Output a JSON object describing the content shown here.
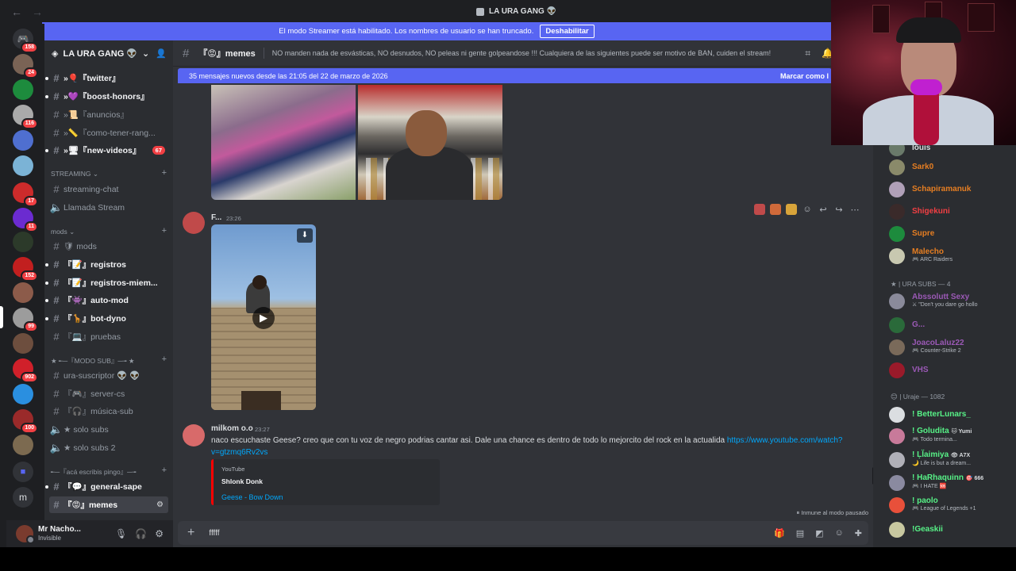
{
  "window": {
    "title": "LA URA GANG 👽",
    "back_glyph": "←",
    "forward_glyph": "→"
  },
  "streamer_banner": {
    "text": "El modo Streamer está habilitado. Los nombres de usuario se han truncado.",
    "button": "Deshabilitar"
  },
  "server_rail": {
    "badges": [
      "158",
      "24",
      "116",
      "17",
      "11",
      "152",
      "99",
      "902",
      "100"
    ],
    "m_label": "m"
  },
  "guild": {
    "name": "LA URA GANG 👽",
    "chevron": "⌄"
  },
  "channels": {
    "twitter": "»🎈『twitter』",
    "boost": "»💜『boost-honors』",
    "anuncios": "»📜『anuncios』",
    "como_tener": "»📏『como-tener-rang...",
    "new_videos": "»🖥『new-videos』",
    "new_videos_count": "67",
    "cat_streaming": "STREAMING ⌄",
    "streaming_chat": "streaming-chat",
    "llamada_stream": "Llamada Stream",
    "cat_mods": "mods ⌄",
    "mods": "🛡 mods",
    "registros": "『📝』registros",
    "registros_miem": "『📝』registros-miem...",
    "auto_mod": "『👾』auto-mod",
    "bot_dyno": "『🦒』bot-dyno",
    "pruebas": "『💻』pruebas",
    "cat_modo_sub": "★ ╾─『MODO SUB』─╼ ★",
    "ura_suscriptor": "ura-suscriptor 👽 👽",
    "server_cs": "『🎮』server-cs",
    "musica_sub": "『🎧』música-sub",
    "solo_subs": "★ solo subs",
    "solo_subs_2": "★ solo subs 2",
    "cat_aca": "╾─『acá escribis pingo』─╼",
    "general_sape": "『💬』general-sape",
    "memes": "『😡』memes"
  },
  "user_panel": {
    "name": "Mr Nacho...",
    "status": "Invisible"
  },
  "chat_header": {
    "channel": "『😡』memes",
    "topic": "NO manden nada de esvásticas, NO desnudos, NO peleas ni gente golpeandose !!! Cualquiera de las siguientes puede ser motivo de BAN, cuiden el stream!"
  },
  "new_messages": {
    "text": "35 mensajes nuevos desde las 21:05 del 22 de marzo de 2026",
    "mark": "Marcar como l"
  },
  "messages": [
    {
      "author": "F...",
      "time": "23:26",
      "color": "#3ba55d"
    },
    {
      "author": "milkom o.o",
      "time": "23:27",
      "color": "#3ba55d",
      "text": "naco escuchaste Geese? creo que con tu voz de negro podrias cantar asi. Dale una chance es dentro de todo lo mejorcito  del rock en la actualida ",
      "link": "https://www.youtube.com/watch?v=gtzmq6Rv2vs",
      "embed": {
        "provider": "YouTube",
        "author": "Shlonk Donk",
        "title": "Geese - Bow Down"
      }
    }
  ],
  "paused_note": "⏸ Inmune al modo pausado",
  "composer": {
    "plus": "+",
    "value": "fffff"
  },
  "members": {
    "top": [
      {
        "name": "louis",
        "activity": "",
        "color": "#dbdee1"
      },
      {
        "name": "Sark0",
        "activity": "",
        "color": "#e67e22"
      },
      {
        "name": "Schapiramanuk",
        "activity": "",
        "color": "#e67e22"
      },
      {
        "name": "Shigekuni",
        "activity": "",
        "color": "#f23f43"
      },
      {
        "name": "Supre",
        "activity": "",
        "color": "#e67e22"
      },
      {
        "name": "Malecho",
        "activity": "🎮 ARC Raiders",
        "color": "#e67e22"
      }
    ],
    "section_subs": "★ | URA SUBS — 4",
    "subs": [
      {
        "name": "Abssolutt Sexy",
        "activity": "⚔ \"Don't you dare go hollo",
        "color": "#9b59b6"
      },
      {
        "name": "G...",
        "activity": "",
        "color": "#9b59b6"
      },
      {
        "name": "JoacoLaluz22",
        "activity": "🎮 Counter-Strike 2",
        "color": "#9b59b6"
      },
      {
        "name": "VHS",
        "activity": "",
        "color": "#9b59b6"
      }
    ],
    "section_uraje": "😊 | Uraje — 1082",
    "uraje": [
      {
        "name": "! BetterLunars_",
        "activity": "",
        "color": "#57f287"
      },
      {
        "name": "! Goludita",
        "activity": "🎮 Todo termina...",
        "color": "#57f287",
        "tag": "🐱 Yumi"
      },
      {
        "name": "! Ḷl̈aimiya",
        "activity": "🌙 Life is but a dream...",
        "color": "#57f287",
        "tag": "👁 A7X"
      },
      {
        "name": "! HaRhaquinn",
        "activity": "🎮 I HATE 🆘",
        "color": "#57f287",
        "tag": "🎯 666"
      },
      {
        "name": "! paolo",
        "activity": "🎮 League of Legends +1",
        "color": "#57f287"
      },
      {
        "name": "!Geaskii",
        "activity": "",
        "color": "#57f287"
      }
    ]
  },
  "colors": {
    "blurple": "#5865f2",
    "bg_main": "#313338",
    "bg_sidebar": "#2b2d31",
    "bg_rail": "#1e1f22",
    "link": "#00a8fc",
    "danger": "#f23f43"
  }
}
